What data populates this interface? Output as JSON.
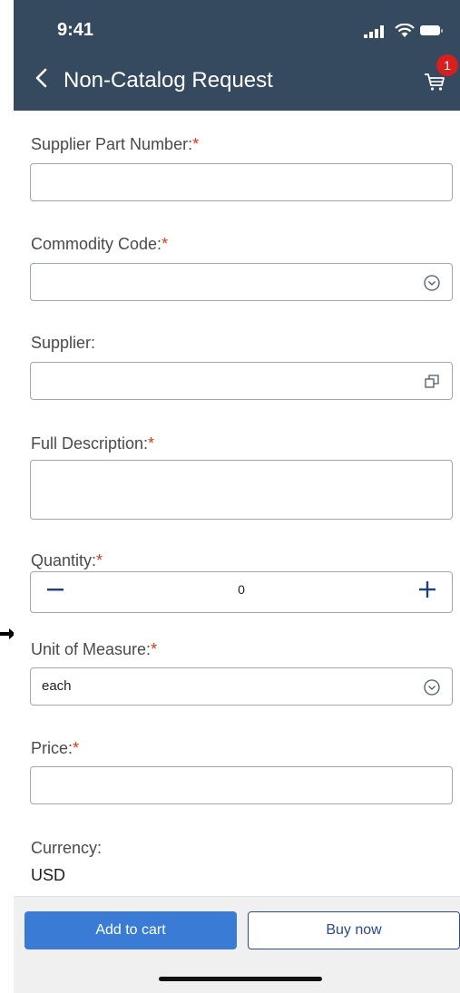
{
  "status_bar": {
    "time": "9:41"
  },
  "header": {
    "title": "Non-Catalog Request",
    "cart_badge": "1"
  },
  "form": {
    "supplier_part_number": {
      "label": "Supplier Part Number:",
      "required_mark": "*",
      "value": ""
    },
    "commodity_code": {
      "label": "Commodity Code:",
      "required_mark": "*",
      "value": ""
    },
    "supplier": {
      "label": "Supplier:",
      "value": ""
    },
    "full_description": {
      "label": "Full Description:",
      "required_mark": "*",
      "value": ""
    },
    "quantity": {
      "label": "Quantity:",
      "required_mark": "*",
      "value": "0"
    },
    "unit_of_measure": {
      "label": "Unit of Measure:",
      "required_mark": "*",
      "value": "each"
    },
    "price": {
      "label": "Price:",
      "required_mark": "*",
      "value": ""
    },
    "currency": {
      "label": "Currency:",
      "value": "USD"
    }
  },
  "footer": {
    "add_to_cart_label": "Add to cart",
    "buy_now_label": "Buy now"
  },
  "icons": {
    "back": "chevron-left-icon",
    "cart": "cart-icon",
    "dropdown": "circle-chevron-down-icon",
    "value_help": "value-help-icon",
    "minus": "minus-icon",
    "plus": "plus-icon"
  },
  "colors": {
    "header_bg": "#354a5f",
    "badge": "#d61f1f",
    "required": "#d63b1a",
    "primary_button": "#3a7bd5",
    "secondary_button_text": "#2a4a8a"
  }
}
